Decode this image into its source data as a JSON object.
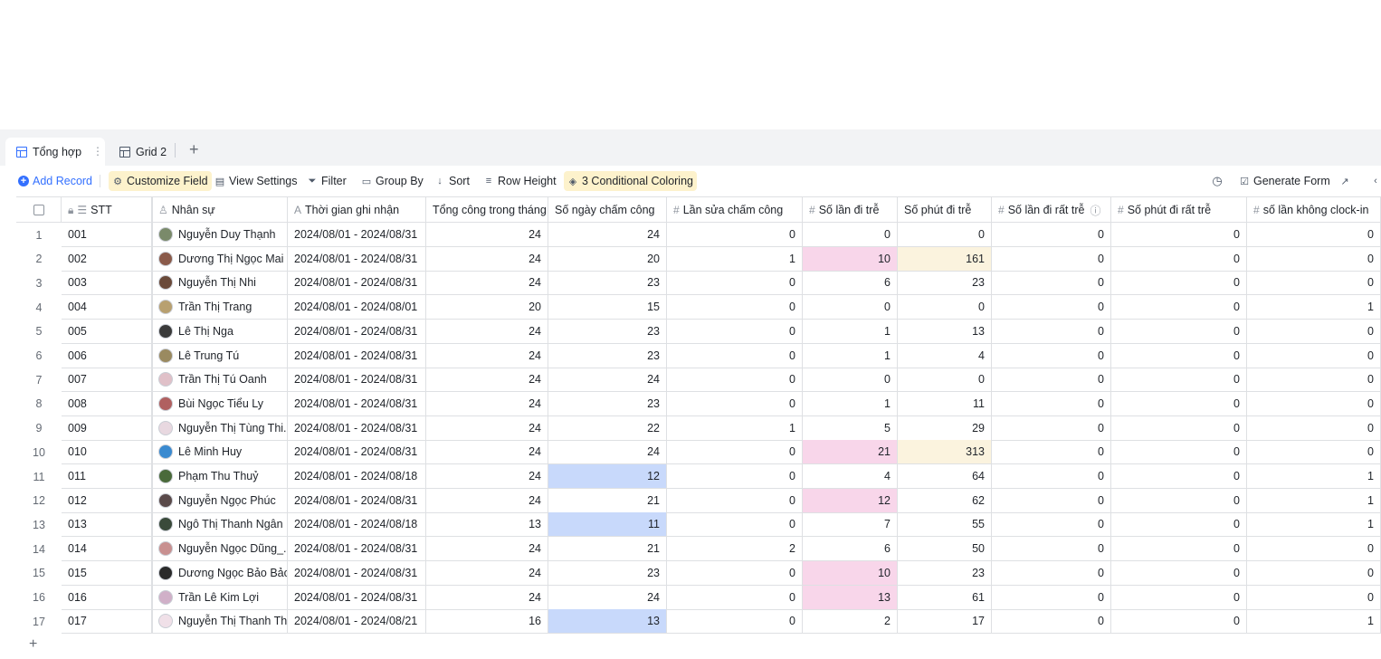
{
  "tabs": [
    {
      "label": "Tổng hợp",
      "active": true
    },
    {
      "label": "Grid 2",
      "active": false
    }
  ],
  "toolbar": {
    "add_record": "Add Record",
    "customize_field": "Customize Field",
    "view_settings": "View Settings",
    "filter": "Filter",
    "group_by": "Group By",
    "sort": "Sort",
    "row_height": "Row Height",
    "conditional_coloring": "3 Conditional Coloring",
    "generate_form": "Generate Form"
  },
  "columns": [
    {
      "key": "stt",
      "label": "STT",
      "icon": "lock-sort-icon"
    },
    {
      "key": "name",
      "label": "Nhân sự",
      "icon": "person-icon"
    },
    {
      "key": "period",
      "label": "Thời gian ghi nhận",
      "icon": "text-icon"
    },
    {
      "key": "total",
      "label": "Tổng công trong tháng",
      "icon": ""
    },
    {
      "key": "days",
      "label": "Số ngày chấm công",
      "icon": ""
    },
    {
      "key": "edits",
      "label": "Lần sửa chấm công",
      "icon": "hash-icon"
    },
    {
      "key": "late",
      "label": "Số lần đi trễ",
      "icon": "hash-icon"
    },
    {
      "key": "late_min",
      "label": "Số phút đi trễ",
      "icon": ""
    },
    {
      "key": "very_late",
      "label": "Số lần đi rất trễ",
      "icon": "hash-icon"
    },
    {
      "key": "very_late_min",
      "label": "Số phút đi rất trễ",
      "icon": "hash-icon"
    },
    {
      "key": "no_clockin",
      "label": "số lần không clock-in",
      "icon": "hash-icon"
    }
  ],
  "colors": {
    "pink": "#f8d6ea",
    "yellow": "#fbf3de",
    "blue": "#c8d9fb",
    "accent": "#3370ff"
  },
  "rows": [
    {
      "n": "1",
      "stt": "001",
      "name": "Nguyễn Duy Thạnh",
      "period": "2024/08/01 - 2024/08/31",
      "total": "24",
      "days": "24",
      "edits": "0",
      "late": "0",
      "late_min": "0",
      "very_late": "0",
      "very_late_min": "0",
      "no_clockin": "0",
      "avatar": "#7a8a6a"
    },
    {
      "n": "2",
      "stt": "002",
      "name": "Dương Thị Ngọc Mai",
      "period": "2024/08/01 - 2024/08/31",
      "total": "24",
      "days": "20",
      "edits": "1",
      "late": "10",
      "late_min": "161",
      "very_late": "0",
      "very_late_min": "0",
      "no_clockin": "0",
      "avatar": "#8a5a4a",
      "hl": {
        "late": "pink",
        "late_min": "yellow"
      }
    },
    {
      "n": "3",
      "stt": "003",
      "name": "Nguyễn Thị  Nhi",
      "period": "2024/08/01 - 2024/08/31",
      "total": "24",
      "days": "23",
      "edits": "0",
      "late": "6",
      "late_min": "23",
      "very_late": "0",
      "very_late_min": "0",
      "no_clockin": "0",
      "avatar": "#6a4a3a"
    },
    {
      "n": "4",
      "stt": "004",
      "name": "Trần Thị Trang",
      "period": "2024/08/01 - 2024/08/01",
      "total": "20",
      "days": "15",
      "edits": "0",
      "late": "0",
      "late_min": "0",
      "very_late": "0",
      "very_late_min": "0",
      "no_clockin": "1",
      "avatar": "#b8a070"
    },
    {
      "n": "5",
      "stt": "005",
      "name": "Lê Thị Nga",
      "period": "2024/08/01 - 2024/08/31",
      "total": "24",
      "days": "23",
      "edits": "0",
      "late": "1",
      "late_min": "13",
      "very_late": "0",
      "very_late_min": "0",
      "no_clockin": "0",
      "avatar": "#3a3a3a"
    },
    {
      "n": "6",
      "stt": "006",
      "name": "Lê Trung Tú",
      "period": "2024/08/01 - 2024/08/31",
      "total": "24",
      "days": "23",
      "edits": "0",
      "late": "1",
      "late_min": "4",
      "very_late": "0",
      "very_late_min": "0",
      "no_clockin": "0",
      "avatar": "#9a8a60"
    },
    {
      "n": "7",
      "stt": "007",
      "name": "Trần Thị Tú Oanh",
      "period": "2024/08/01 - 2024/08/31",
      "total": "24",
      "days": "24",
      "edits": "0",
      "late": "0",
      "late_min": "0",
      "very_late": "0",
      "very_late_min": "0",
      "no_clockin": "0",
      "avatar": "#e0c0c8"
    },
    {
      "n": "8",
      "stt": "008",
      "name": "Bùi Ngọc Tiểu Ly",
      "period": "2024/08/01 - 2024/08/31",
      "total": "24",
      "days": "23",
      "edits": "0",
      "late": "1",
      "late_min": "11",
      "very_late": "0",
      "very_late_min": "0",
      "no_clockin": "0",
      "avatar": "#b06060"
    },
    {
      "n": "9",
      "stt": "009",
      "name": "Nguyễn Thị Tùng Thi...",
      "period": "2024/08/01 - 2024/08/31",
      "total": "24",
      "days": "22",
      "edits": "1",
      "late": "5",
      "late_min": "29",
      "very_late": "0",
      "very_late_min": "0",
      "no_clockin": "0",
      "avatar": "#e8d8e0"
    },
    {
      "n": "10",
      "stt": "010",
      "name": "Lê Minh Huy",
      "period": "2024/08/01 - 2024/08/31",
      "total": "24",
      "days": "24",
      "edits": "0",
      "late": "21",
      "late_min": "313",
      "very_late": "0",
      "very_late_min": "0",
      "no_clockin": "0",
      "avatar": "#3a8ad0",
      "hl": {
        "late": "pink",
        "late_min": "yellow"
      }
    },
    {
      "n": "11",
      "stt": "011",
      "name": "Phạm Thu Thuỷ",
      "period": "2024/08/01 - 2024/08/18",
      "total": "24",
      "days": "12",
      "edits": "0",
      "late": "4",
      "late_min": "64",
      "very_late": "0",
      "very_late_min": "0",
      "no_clockin": "1",
      "avatar": "#4a6a3a",
      "hl": {
        "days": "blue"
      }
    },
    {
      "n": "12",
      "stt": "012",
      "name": "Nguyễn Ngọc Phúc",
      "period": "2024/08/01 - 2024/08/31",
      "total": "24",
      "days": "21",
      "edits": "0",
      "late": "12",
      "late_min": "62",
      "very_late": "0",
      "very_late_min": "0",
      "no_clockin": "1",
      "avatar": "#5a4a4a",
      "hl": {
        "late": "pink"
      }
    },
    {
      "n": "13",
      "stt": "013",
      "name": "Ngô Thị Thanh Ngân",
      "period": "2024/08/01 - 2024/08/18",
      "total": "13",
      "days": "11",
      "edits": "0",
      "late": "7",
      "late_min": "55",
      "very_late": "0",
      "very_late_min": "0",
      "no_clockin": "1",
      "avatar": "#3a4a3a",
      "hl": {
        "days": "blue"
      }
    },
    {
      "n": "14",
      "stt": "014",
      "name": "Nguyễn Ngọc Dũng_...",
      "period": "2024/08/01 - 2024/08/31",
      "total": "24",
      "days": "21",
      "edits": "2",
      "late": "6",
      "late_min": "50",
      "very_late": "0",
      "very_late_min": "0",
      "no_clockin": "0",
      "avatar": "#c89090"
    },
    {
      "n": "15",
      "stt": "015",
      "name": "Dương Ngọc Bảo Bảo",
      "period": "2024/08/01 - 2024/08/31",
      "total": "24",
      "days": "23",
      "edits": "0",
      "late": "10",
      "late_min": "23",
      "very_late": "0",
      "very_late_min": "0",
      "no_clockin": "0",
      "avatar": "#2a2a2a",
      "hl": {
        "late": "pink"
      }
    },
    {
      "n": "16",
      "stt": "016",
      "name": "Trần Lê Kim Lợi",
      "period": "2024/08/01 - 2024/08/31",
      "total": "24",
      "days": "24",
      "edits": "0",
      "late": "13",
      "late_min": "61",
      "very_late": "0",
      "very_late_min": "0",
      "no_clockin": "0",
      "avatar": "#d0b0c8",
      "hl": {
        "late": "pink"
      }
    },
    {
      "n": "17",
      "stt": "017",
      "name": "Nguyễn Thị Thanh Thư",
      "period": "2024/08/01 - 2024/08/21",
      "total": "16",
      "days": "13",
      "edits": "0",
      "late": "2",
      "late_min": "17",
      "very_late": "0",
      "very_late_min": "0",
      "no_clockin": "1",
      "avatar": "#f0e0e8",
      "hl": {
        "days": "blue"
      }
    }
  ]
}
